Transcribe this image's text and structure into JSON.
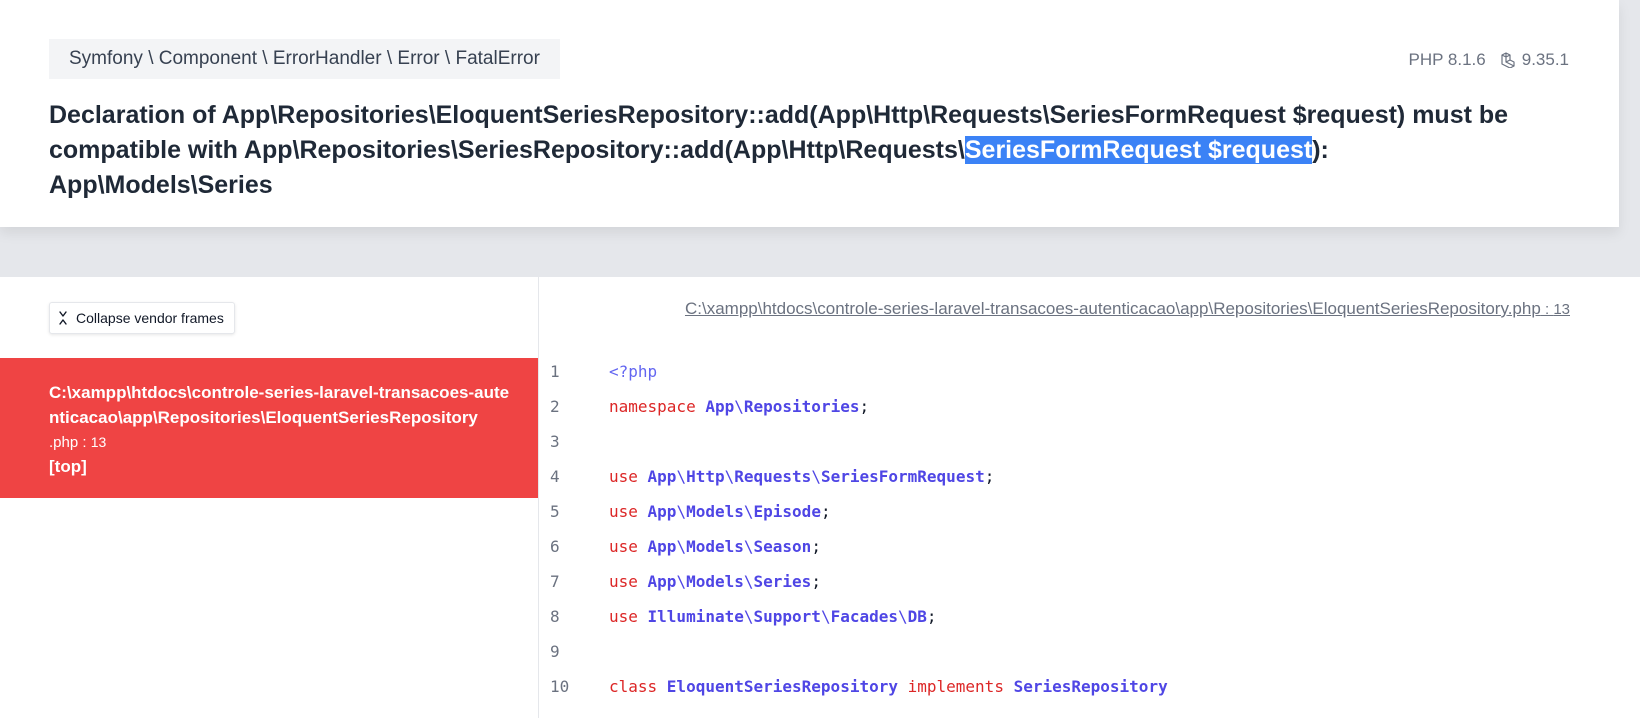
{
  "header": {
    "exception_class": "Symfony \\ Component \\ ErrorHandler \\ Error \\ FatalError",
    "php_version": "PHP 8.1.6",
    "laravel_version": "9.35.1",
    "message_line1": "Declaration of App\\Repositories\\EloquentSeriesRepository::add(App\\Http\\Requests\\SeriesFormRequest $request) must be",
    "message_line2_before": "compatible with App\\Repositories\\SeriesRepository::add(App\\Http\\Requests\\",
    "message_line2_selected": "SeriesFormRequest $request",
    "message_line2_after": "): App\\Models\\Series",
    "selection_color": "#3b82f6"
  },
  "sidebar": {
    "collapse_label": "Collapse vendor frames",
    "frame": {
      "path": "C:\\xampp\\htdocs\\controle-series-laravel-transacoes-autenticacao\\app\\Repositories\\EloquentSeriesRepository",
      "ext": ".php",
      "line": "13",
      "badge": "[top]",
      "color": "#ef4444"
    }
  },
  "editor": {
    "file_path": "C:\\xampp\\htdocs\\controle-series-laravel-transacoes-autenticacao\\app\\Repositories\\EloquentSeriesRepository",
    "file_ext": ".php",
    "file_line": "13",
    "lines": [
      {
        "n": "1",
        "t": [
          {
            "c": "tag",
            "v": "<?php"
          }
        ]
      },
      {
        "n": "2",
        "t": [
          {
            "c": "kw",
            "v": "namespace "
          },
          {
            "c": "id",
            "v": "App"
          },
          {
            "c": "sl",
            "v": "\\"
          },
          {
            "c": "id",
            "v": "Repositories"
          },
          {
            "c": "pl",
            "v": ";"
          }
        ]
      },
      {
        "n": "3",
        "t": []
      },
      {
        "n": "4",
        "t": [
          {
            "c": "kw",
            "v": "use "
          },
          {
            "c": "id",
            "v": "App"
          },
          {
            "c": "sl",
            "v": "\\"
          },
          {
            "c": "id",
            "v": "Http"
          },
          {
            "c": "sl",
            "v": "\\"
          },
          {
            "c": "id",
            "v": "Requests"
          },
          {
            "c": "sl",
            "v": "\\"
          },
          {
            "c": "id",
            "v": "SeriesFormRequest"
          },
          {
            "c": "pl",
            "v": ";"
          }
        ]
      },
      {
        "n": "5",
        "t": [
          {
            "c": "kw",
            "v": "use "
          },
          {
            "c": "id",
            "v": "App"
          },
          {
            "c": "sl",
            "v": "\\"
          },
          {
            "c": "id",
            "v": "Models"
          },
          {
            "c": "sl",
            "v": "\\"
          },
          {
            "c": "id",
            "v": "Episode"
          },
          {
            "c": "pl",
            "v": ";"
          }
        ]
      },
      {
        "n": "6",
        "t": [
          {
            "c": "kw",
            "v": "use "
          },
          {
            "c": "id",
            "v": "App"
          },
          {
            "c": "sl",
            "v": "\\"
          },
          {
            "c": "id",
            "v": "Models"
          },
          {
            "c": "sl",
            "v": "\\"
          },
          {
            "c": "id",
            "v": "Season"
          },
          {
            "c": "pl",
            "v": ";"
          }
        ]
      },
      {
        "n": "7",
        "t": [
          {
            "c": "kw",
            "v": "use "
          },
          {
            "c": "id",
            "v": "App"
          },
          {
            "c": "sl",
            "v": "\\"
          },
          {
            "c": "id",
            "v": "Models"
          },
          {
            "c": "sl",
            "v": "\\"
          },
          {
            "c": "id",
            "v": "Series"
          },
          {
            "c": "pl",
            "v": ";"
          }
        ]
      },
      {
        "n": "8",
        "t": [
          {
            "c": "kw",
            "v": "use "
          },
          {
            "c": "id",
            "v": "Illuminate"
          },
          {
            "c": "sl",
            "v": "\\"
          },
          {
            "c": "id",
            "v": "Support"
          },
          {
            "c": "sl",
            "v": "\\"
          },
          {
            "c": "id",
            "v": "Facades"
          },
          {
            "c": "sl",
            "v": "\\"
          },
          {
            "c": "id",
            "v": "DB"
          },
          {
            "c": "pl",
            "v": ";"
          }
        ]
      },
      {
        "n": "9",
        "t": []
      },
      {
        "n": "10",
        "t": [
          {
            "c": "kw",
            "v": "class "
          },
          {
            "c": "id",
            "v": "EloquentSeriesRepository"
          },
          {
            "c": "kw",
            "v": " implements "
          },
          {
            "c": "id",
            "v": "SeriesRepository"
          }
        ]
      }
    ]
  }
}
